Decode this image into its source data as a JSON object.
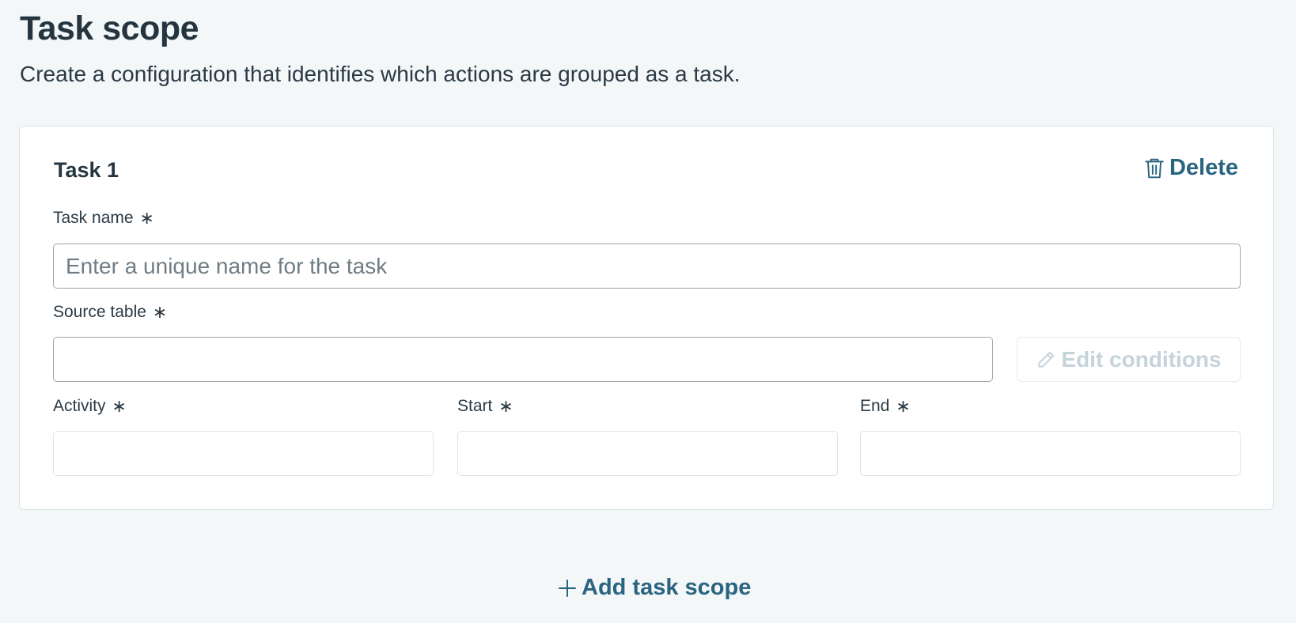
{
  "header": {
    "title": "Task scope",
    "description": "Create a configuration that identifies which actions are grouped as a task."
  },
  "task": {
    "title": "Task 1",
    "delete_label": "Delete",
    "fields": {
      "task_name": {
        "label": "Task name",
        "placeholder": "Enter a unique name for the task",
        "value": ""
      },
      "source_table": {
        "label": "Source table",
        "value": ""
      },
      "activity": {
        "label": "Activity",
        "value": ""
      },
      "start": {
        "label": "Start",
        "value": ""
      },
      "end": {
        "label": "End",
        "value": ""
      }
    },
    "required_marker": "∗",
    "edit_conditions_label": "Edit conditions"
  },
  "footer": {
    "add_label": "Add task scope"
  },
  "colors": {
    "accent": "#2a6480",
    "disabled_text": "#c5d3da",
    "background": "#f3f7f8"
  },
  "icons": {
    "delete": "trash-icon",
    "edit": "pencil-icon",
    "add": "plus-icon"
  }
}
